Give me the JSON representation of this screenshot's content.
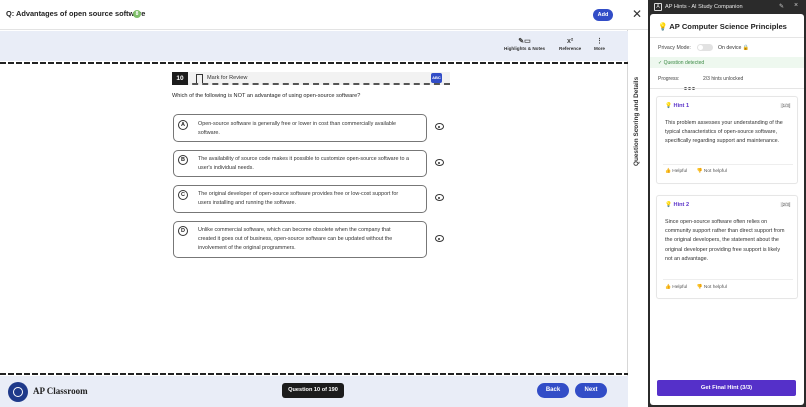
{
  "main": {
    "question_title": "Q: Advantages of open source software",
    "add_label": "Add",
    "close_glyph": "✕",
    "toolbar": {
      "highlights_label": "Highlights & Notes",
      "reference_label": "Reference",
      "more_label": "More"
    },
    "side_panel_label": "Question Scoring and Details",
    "question": {
      "number": "10",
      "mark_label": "Mark for Review",
      "abc_label": "ABC",
      "prompt": "Which of the following is NOT an advantage of using open-source software?",
      "choices": [
        {
          "letter": "A",
          "text": "Open-source software is generally free or lower in cost than commercially available software."
        },
        {
          "letter": "B",
          "text": "The availability of source code makes it possible to customize open-source software to a user's individual needs."
        },
        {
          "letter": "C",
          "text": "The original developer of open-source software provides free or low-cost support for users installing and running the software."
        },
        {
          "letter": "D",
          "text": "Unlike commercial software, which can become obsolete when the company that created it goes out of business, open-source software can be updated without the involvement of the original programmers."
        }
      ]
    },
    "footer": {
      "brand": "AP Classroom",
      "counter": "Question 10 of 190",
      "back_label": "Back",
      "next_label": "Next"
    }
  },
  "extension": {
    "window_title": "AP Hints - AI Study Companion",
    "title": "AP Computer Science Principles",
    "privacy_label": "Privacy Mode:",
    "on_device_label": "On device 🔒",
    "detected_label": "✓ Question detected",
    "progress_label": "Progress:",
    "progress_value": "2/3 hints unlocked",
    "progress_fraction": 0.667,
    "hints": [
      {
        "title": "Hint 1",
        "count": "[1/3]",
        "body": "This problem assesses your understanding of the typical characteristics of open-source software, specifically regarding support and maintenance.",
        "helpful": "👍 Helpful",
        "not_helpful": "👎 Not helpful"
      },
      {
        "title": "Hint 2",
        "count": "[2/3]",
        "body": "Since open-source software often relies on community support rather than direct support from the original developers, the statement about the original developer providing free support is likely not an advantage.",
        "helpful": "👍 Helpful",
        "not_helpful": "👎 Not helpful"
      }
    ],
    "final_button": "Get Final Hint (3/3)"
  },
  "colors": {
    "accent_blue": "#324dc7",
    "hint_purple": "#5530c9",
    "toolbar_band": "#e9edf7"
  }
}
